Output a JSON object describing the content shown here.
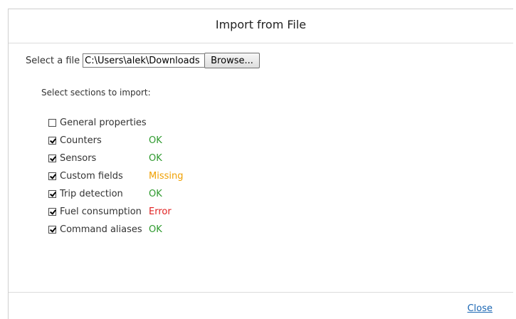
{
  "dialog": {
    "title": "Import from File",
    "file_label": "Select a file",
    "file_value": "C:\\Users\\alek\\Downloads",
    "browse_label": "Browse...",
    "sections_label": "Select sections to import:",
    "sections": [
      {
        "label": "General properties",
        "checked": false,
        "status": "",
        "status_color": ""
      },
      {
        "label": "Counters",
        "checked": true,
        "status": "OK",
        "status_color": "#2e9a2e"
      },
      {
        "label": "Sensors",
        "checked": true,
        "status": "OK",
        "status_color": "#2e9a2e"
      },
      {
        "label": "Custom fields",
        "checked": true,
        "status": "Missing",
        "status_color": "#f0a000"
      },
      {
        "label": "Trip detection",
        "checked": true,
        "status": "OK",
        "status_color": "#2e9a2e"
      },
      {
        "label": "Fuel consumption",
        "checked": true,
        "status": "Error",
        "status_color": "#e02020"
      },
      {
        "label": "Command aliases",
        "checked": true,
        "status": "OK",
        "status_color": "#2e9a2e"
      }
    ],
    "close_label": "Close"
  }
}
